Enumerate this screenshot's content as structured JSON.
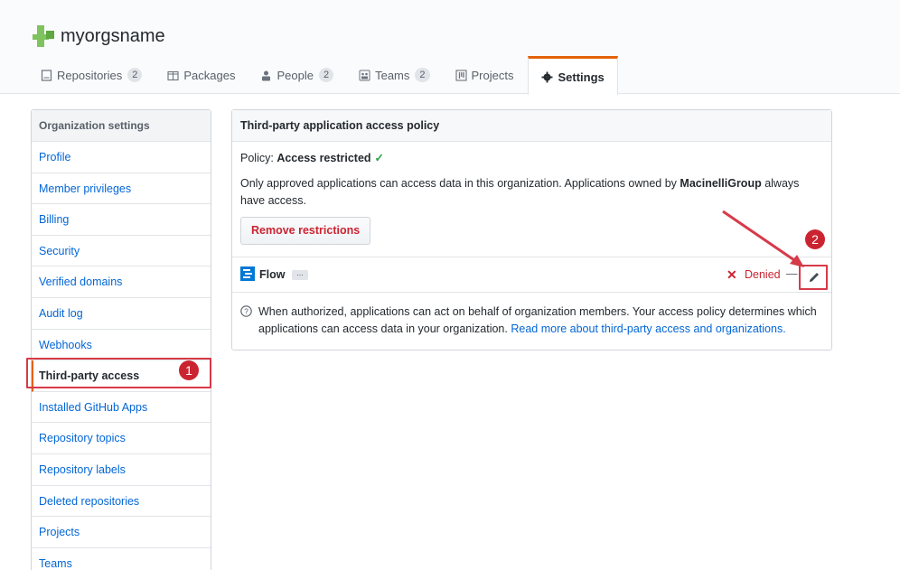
{
  "org": {
    "name": "myorgsname"
  },
  "tabs": [
    {
      "label": "Repositories",
      "count": "2",
      "icon": "repo-icon"
    },
    {
      "label": "Packages",
      "count": null,
      "icon": "package-icon"
    },
    {
      "label": "People",
      "count": "2",
      "icon": "person-icon"
    },
    {
      "label": "Teams",
      "count": "2",
      "icon": "team-icon"
    },
    {
      "label": "Projects",
      "count": null,
      "icon": "project-icon"
    },
    {
      "label": "Settings",
      "count": null,
      "icon": "gear-icon",
      "selected": true
    }
  ],
  "sidebar": {
    "heading": "Organization settings",
    "items": [
      {
        "label": "Profile"
      },
      {
        "label": "Member privileges"
      },
      {
        "label": "Billing"
      },
      {
        "label": "Security"
      },
      {
        "label": "Verified domains"
      },
      {
        "label": "Audit log"
      },
      {
        "label": "Webhooks"
      },
      {
        "label": "Third-party access",
        "active": true
      },
      {
        "label": "Installed GitHub Apps"
      },
      {
        "label": "Repository topics"
      },
      {
        "label": "Repository labels"
      },
      {
        "label": "Deleted repositories"
      },
      {
        "label": "Projects"
      },
      {
        "label": "Teams"
      }
    ]
  },
  "panel": {
    "title": "Third-party application access policy",
    "policy_prefix": "Policy:",
    "policy_value": "Access restricted",
    "desc_part1": "Only approved applications can access data in this organization. Applications owned by ",
    "desc_owner": "MacinelliGroup",
    "desc_part2": " always have access.",
    "remove_button": "Remove restrictions",
    "app": {
      "name": "Flow",
      "more": "...",
      "status": "Denied",
      "separator": "—"
    },
    "info_text": "When authorized, applications can act on behalf of organization members. Your access policy determines which applications can access data in your organization. ",
    "info_link": "Read more about third-party access and organizations."
  },
  "annotations": {
    "step1": "1",
    "step2": "2"
  },
  "colors": {
    "accent_orange": "#e36209",
    "link_blue": "#0366d6",
    "danger_red": "#cb2431",
    "success_green": "#28a745",
    "annotation_red": "#d73a49"
  }
}
